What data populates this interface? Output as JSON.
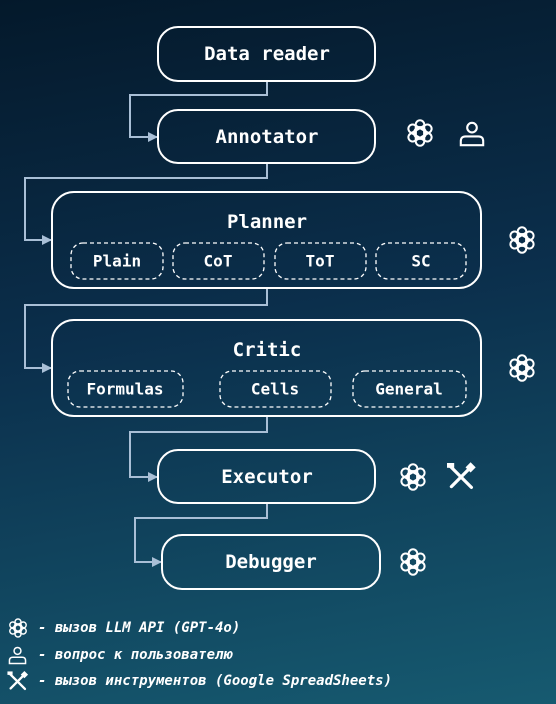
{
  "colors": {
    "box_stroke": "#ffffff",
    "connector": "#a9bfd6",
    "background_top": "#04192b",
    "background_bottom": "#165a70"
  },
  "nodes": {
    "data_reader": {
      "label": "Data reader",
      "icons": []
    },
    "annotator": {
      "label": "Annotator",
      "icons": [
        "openai-icon",
        "user-icon"
      ]
    },
    "planner": {
      "label": "Planner",
      "icons": [
        "openai-icon"
      ],
      "options": [
        "Plain",
        "CoT",
        "ToT",
        "SC"
      ]
    },
    "critic": {
      "label": "Critic",
      "icons": [
        "openai-icon"
      ],
      "options": [
        "Formulas",
        "Cells",
        "General"
      ]
    },
    "executor": {
      "label": "Executor",
      "icons": [
        "openai-icon",
        "tools-icon"
      ]
    },
    "debugger": {
      "label": "Debugger",
      "icons": [
        "openai-icon"
      ]
    }
  },
  "legend": [
    {
      "icon": "openai-icon",
      "text": "- вызов LLM API (GPT-4o)"
    },
    {
      "icon": "user-icon",
      "text": "- вопрос к пользователю"
    },
    {
      "icon": "tools-icon",
      "text": "- вызов инструментов (Google SpreadSheets)"
    }
  ]
}
